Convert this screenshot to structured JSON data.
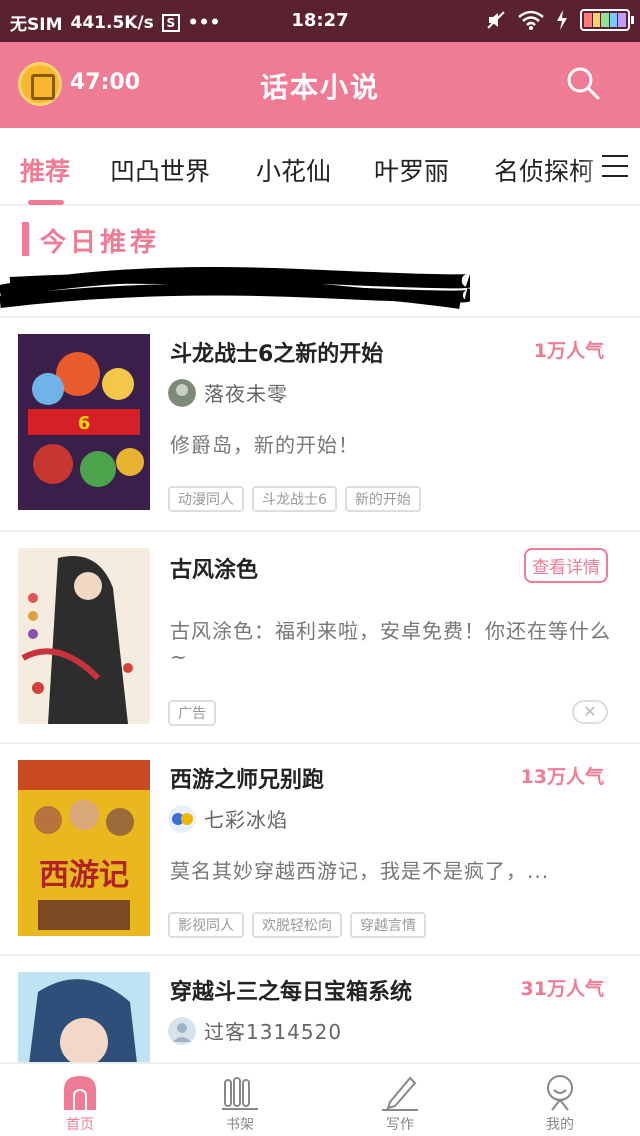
{
  "status_bar": {
    "carrier": "无SIM",
    "speed": "441.5K/s",
    "s_badge": "S",
    "dots": "•••",
    "time": "18:27"
  },
  "header": {
    "timer": "47:00",
    "title": "话本小说"
  },
  "tabs": [
    {
      "label": "推荐",
      "active": true
    },
    {
      "label": "凹凸世界",
      "active": false
    },
    {
      "label": "小花仙",
      "active": false
    },
    {
      "label": "叶罗丽",
      "active": false
    },
    {
      "label": "名侦探柯",
      "active": false
    }
  ],
  "section": {
    "title": "今日推荐"
  },
  "cards": [
    {
      "title": "斗龙战士6之新的开始",
      "popularity": "1万人气",
      "author": "落夜未零",
      "description": "修爵岛，新的开始！",
      "tags": [
        "动漫同人",
        "斗龙战士6",
        "新的开始"
      ]
    },
    {
      "title": "古风涂色",
      "detail_button": "查看详情",
      "description": "古风涂色：福利来啦，安卓免费！你还在等什么~",
      "ad_label": "广告",
      "close_symbol": "✕"
    },
    {
      "title": "西游之师兄别跑",
      "popularity": "13万人气",
      "author": "七彩冰焰",
      "description": "莫名其妙穿越西游记，我是不是疯了，...",
      "tags": [
        "影视同人",
        "欢脱轻松向",
        "穿越言情"
      ]
    },
    {
      "title": "穿越斗三之每日宝箱系统",
      "popularity": "31万人气",
      "author": "过客1314520"
    }
  ],
  "bottom_nav": [
    {
      "label": "首页",
      "icon": "home-icon",
      "active": true
    },
    {
      "label": "书架",
      "icon": "bookshelf-icon",
      "active": false
    },
    {
      "label": "写作",
      "icon": "pen-icon",
      "active": false
    },
    {
      "label": "我的",
      "icon": "profile-icon",
      "active": false
    }
  ],
  "colors": {
    "accent": "#f07b95",
    "status_bar": "#5a2230"
  }
}
